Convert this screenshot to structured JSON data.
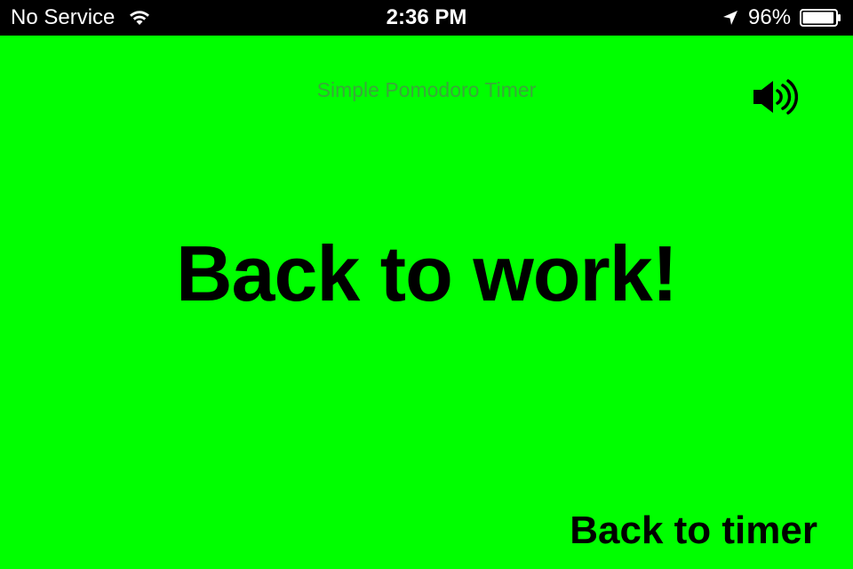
{
  "status_bar": {
    "carrier": "No Service",
    "time": "2:36 PM",
    "battery_percent": "96%",
    "wifi_icon": "wifi-icon",
    "location_icon": "location-arrow-icon",
    "battery_icon": "battery-icon",
    "battery_level": 0.96
  },
  "app": {
    "title": "Simple Pomodoro Timer",
    "sound_icon": "speaker-volume-icon",
    "message": "Back to work!",
    "back_button_label": "Back to timer"
  },
  "colors": {
    "background": "#00ff00",
    "status_bar": "#000000",
    "title_text": "#3aa83a",
    "primary_text": "#000000"
  }
}
